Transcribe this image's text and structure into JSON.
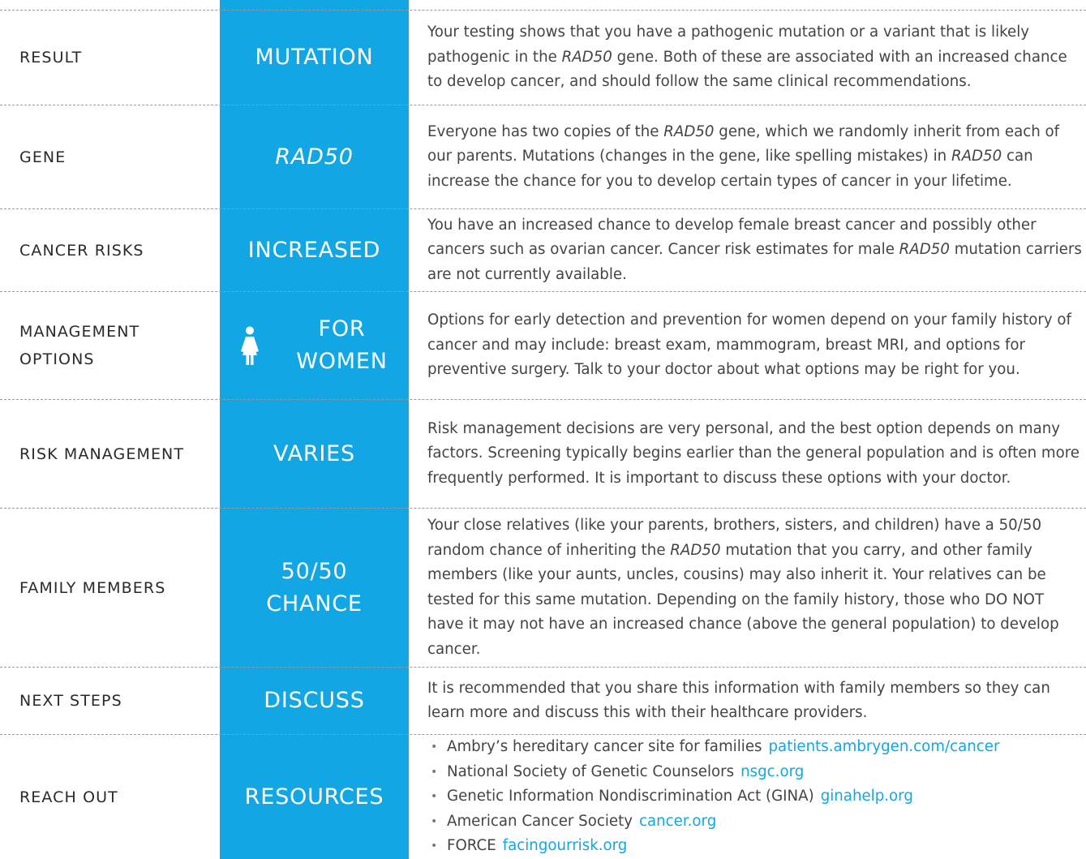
{
  "colors": {
    "accent_band": "#12a6e4",
    "link": "#12a6e4",
    "label_text": "#2a2a2a",
    "body_text": "#444444"
  },
  "rows": [
    {
      "label_lines": [
        "RESULT"
      ],
      "value_lines": [
        "MUTATION"
      ],
      "desc": {
        "t1": " Your testing shows that you have a pathogenic mutation or a variant that is likely pathogenic in the ",
        "gene": "RAD50",
        "t2": " gene. Both of these are associated with an increased chance to develop cancer, and should follow the same clinical recommendations."
      }
    },
    {
      "label_lines": [
        "GENE"
      ],
      "value_lines": [
        "RAD50"
      ],
      "desc": {
        "t1": "Everyone has two copies of the ",
        "gene1": "RAD50",
        "t2": " gene, which we randomly inherit from each of our parents. Mutations (changes in the gene, like spelling mistakes) in ",
        "gene2": "RAD50",
        "t3": " can increase the chance for you to develop certain types of cancer in your lifetime."
      }
    },
    {
      "label_lines": [
        "CANCER RISKS"
      ],
      "value_lines": [
        "INCREASED"
      ],
      "desc": {
        "t1": "You have an increased chance to develop female breast cancer and possibly other cancers such as ovarian cancer. Cancer risk estimates for male ",
        "gene": "RAD50",
        "t2": " mutation carriers are not currently available."
      }
    },
    {
      "label_lines": [
        "MANAGEMENT",
        "OPTIONS"
      ],
      "value_lines": [
        "FOR",
        "WOMEN"
      ],
      "value_icon": "woman-figure-icon",
      "desc": {
        "t1": "Options for early detection and prevention for women depend on your family history of cancer and may include: breast exam, mammogram, breast MRI, and options for preventive surgery. Talk to your doctor about what options may be right for you."
      }
    },
    {
      "label_lines": [
        "RISK MANAGEMENT"
      ],
      "value_lines": [
        "VARIES"
      ],
      "desc": {
        "t1": "Risk management decisions are very personal, and the best option depends on many factors. Screening typically begins earlier than the general population and is often more frequently performed. It is important to discuss these options with your doctor."
      }
    },
    {
      "label_lines": [
        "FAMILY MEMBERS"
      ],
      "value_lines": [
        "50/50",
        "CHANCE"
      ],
      "desc": {
        "t1": "Your close relatives (like your parents, brothers, sisters, and children) have a 50/50 random chance of inheriting the ",
        "gene": "RAD50",
        "t2": " mutation that you carry, and other family members (like your aunts, uncles, cousins) may also inherit it. Your relatives can be tested for this same mutation. Depending on the family history, those who DO NOT have it may not have an increased chance (above the general population) to develop cancer."
      }
    },
    {
      "label_lines": [
        "NEXT STEPS"
      ],
      "value_lines": [
        "DISCUSS"
      ],
      "desc": {
        "t1": "It is recommended that you share this information with family members so they can learn more and discuss this with their healthcare providers."
      }
    },
    {
      "label_lines": [
        "REACH OUT"
      ],
      "value_lines": [
        "RESOURCES"
      ],
      "resources": [
        {
          "text": "Ambry’s hereditary cancer site for families",
          "link": "patients.ambrygen.com/cancer"
        },
        {
          "text": "National Society of Genetic Counselors",
          "link": "nsgc.org"
        },
        {
          "text": "Genetic Information Nondiscrimination Act (GINA)",
          "link": "ginahelp.org"
        },
        {
          "text": "American Cancer Society",
          "link": "cancer.org"
        },
        {
          "text": "FORCE",
          "link": "facingourrisk.org"
        }
      ]
    }
  ]
}
